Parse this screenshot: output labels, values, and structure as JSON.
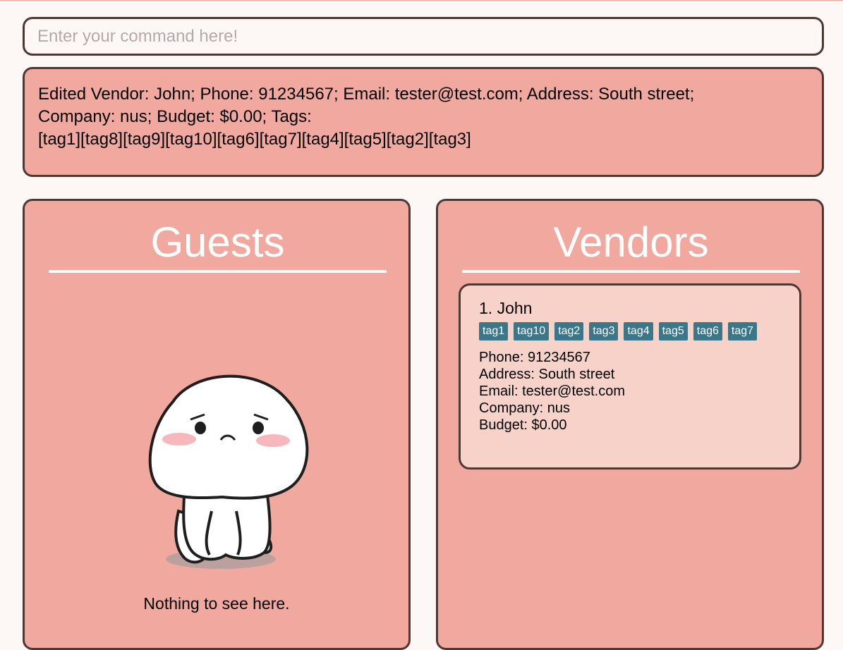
{
  "command": {
    "placeholder": "Enter your command here!",
    "value": ""
  },
  "result": {
    "line1": "Edited Vendor: John; Phone: 91234567; Email: tester@test.com; Address: South street;",
    "line2": "Company: nus; Budget: $0.00; Tags:",
    "line3": "[tag1][tag8][tag9][tag10][tag6][tag7][tag4][tag5][tag2][tag3]"
  },
  "guests": {
    "title": "Guests",
    "empty_text": "Nothing to see here.",
    "empty_icon": "sad-blob-illustration"
  },
  "vendors": {
    "title": "Vendors",
    "items": [
      {
        "name": "1. John",
        "tags": [
          "tag1",
          "tag10",
          "tag2",
          "tag3",
          "tag4",
          "tag5",
          "tag6",
          "tag7"
        ],
        "phone": "Phone: 91234567",
        "address": "Address: South street",
        "email": "Email: tester@test.com",
        "company": "Company: nus",
        "budget": "Budget: $0.00"
      }
    ]
  },
  "colors": {
    "panel": "#f0a89f",
    "card": "#f7d2c9",
    "border": "#4e3833",
    "tag": "#3b7689",
    "background": "#fdf7f6"
  }
}
